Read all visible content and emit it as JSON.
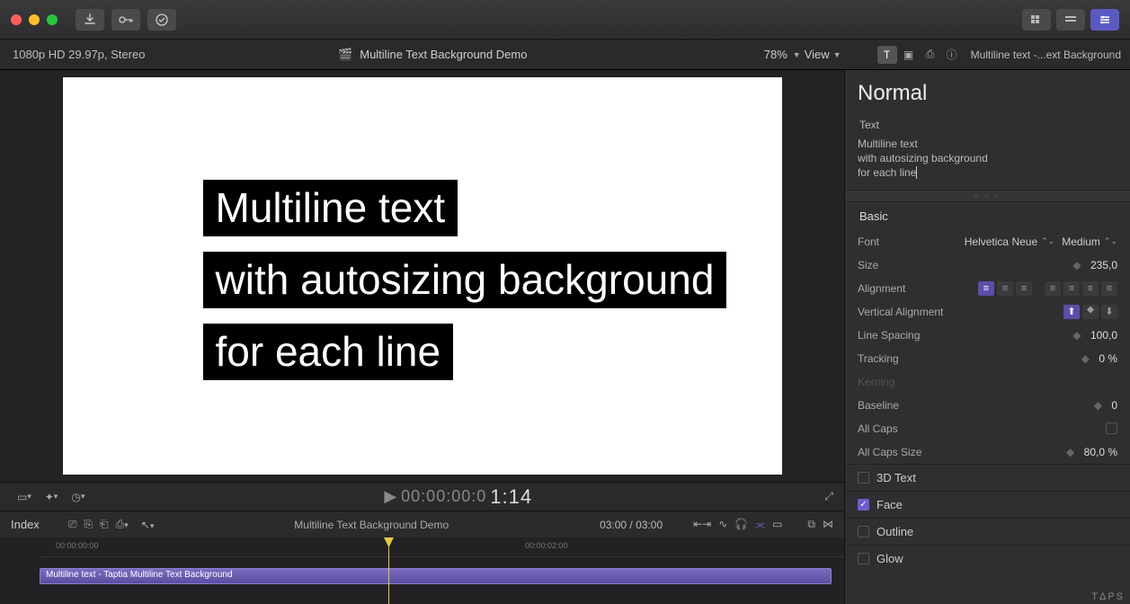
{
  "titlebar": {
    "buttons": [
      "download",
      "key",
      "check"
    ]
  },
  "subhead": {
    "format": "1080p HD 29.97p, Stereo",
    "project": "Multiline Text Background Demo",
    "zoom": "78%",
    "view": "View",
    "clip_name": "Multiline text -...ext Background"
  },
  "canvas": {
    "line1": "Multiline text",
    "line2": "with autosizing background",
    "line3": "for each line"
  },
  "playbar": {
    "tc_gray": "00:00:00:0",
    "tc_big": "1:14"
  },
  "timeline_toolbar": {
    "index": "Index",
    "project": "Multiline Text Background Demo",
    "duration": "03:00 / 03:00"
  },
  "timeline": {
    "ruler_0": "00:00:00:00",
    "ruler_2": "00:00:02:00",
    "clip": "Multiline text - Taptia Multiline Text Background"
  },
  "inspector": {
    "style": "Normal",
    "text_label": "Text",
    "text_content_l1": "Multiline text",
    "text_content_l2": "with autosizing background",
    "text_content_l3": "for each line",
    "basic": "Basic",
    "font_label": "Font",
    "font_family": "Helvetica Neue",
    "font_weight": "Medium",
    "size_label": "Size",
    "size_value": "235,0",
    "align_label": "Alignment",
    "valign_label": "Vertical Alignment",
    "linespace_label": "Line Spacing",
    "linespace_value": "100,0",
    "tracking_label": "Tracking",
    "tracking_value": "0 %",
    "kerning_label": "Kerning",
    "baseline_label": "Baseline",
    "baseline_value": "0",
    "allcaps_label": "All Caps",
    "allcaps_size_label": "All Caps Size",
    "allcaps_size_value": "80,0 %",
    "fx_3dtext": "3D Text",
    "fx_face": "Face",
    "fx_outline": "Outline",
    "fx_glow": "Glow"
  },
  "watermark": "TΔPS"
}
